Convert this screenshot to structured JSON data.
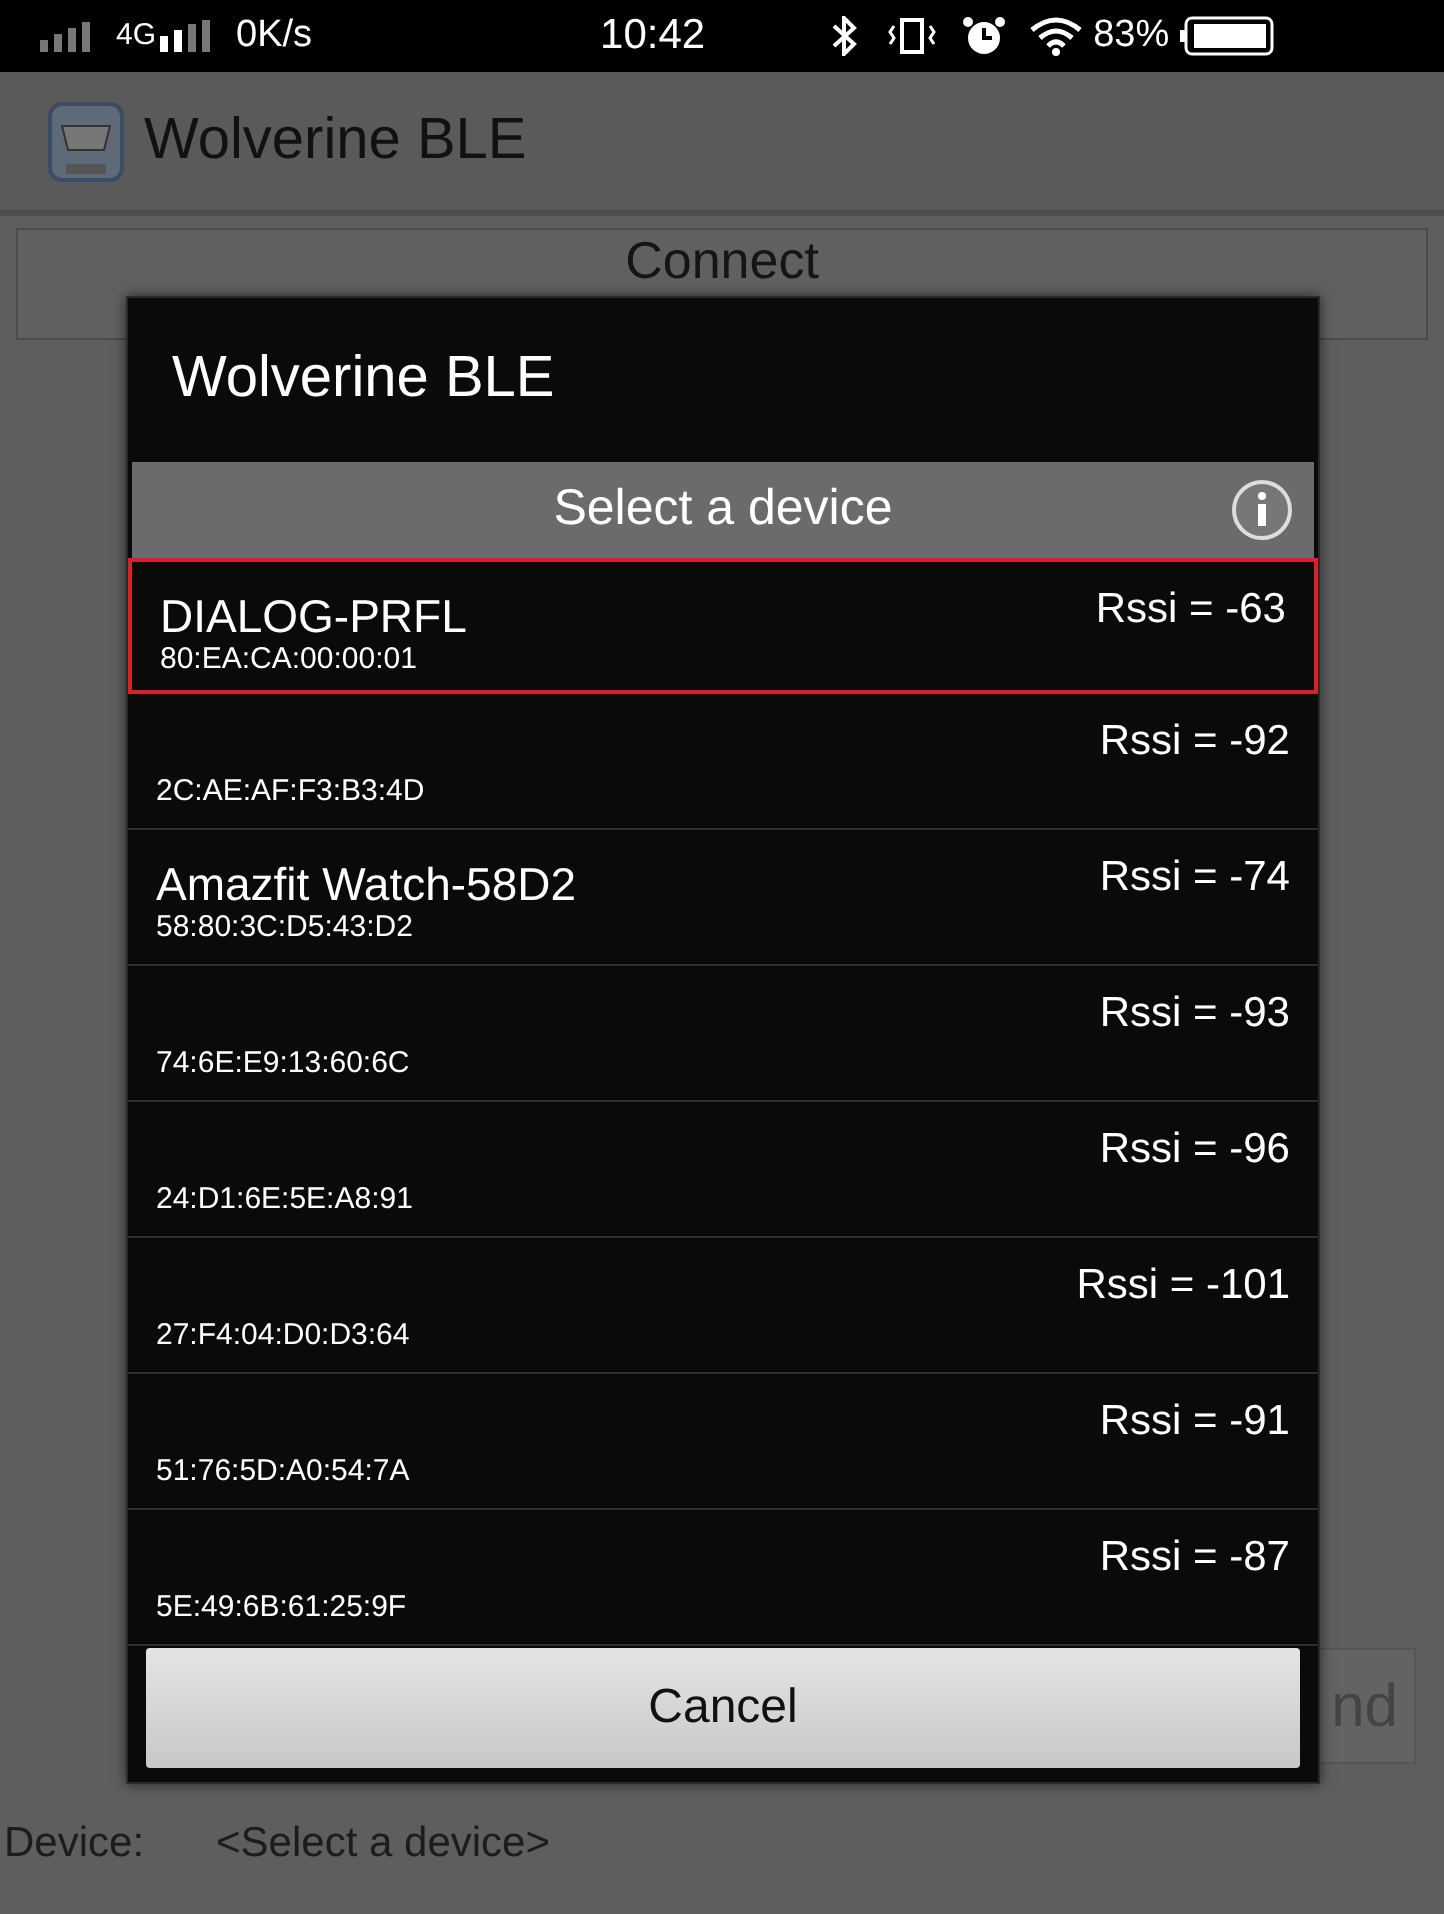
{
  "status_bar": {
    "network": "4G",
    "speed": "0K/s",
    "time": "10:42",
    "battery": "83%"
  },
  "app_bar": {
    "title": "Wolverine BLE"
  },
  "connect_button": "Connect",
  "send_button": "nd",
  "device_row": {
    "label": "Device:",
    "value": "<Select a device>"
  },
  "dialog": {
    "title": "Wolverine BLE",
    "header": "Select a device",
    "devices": [
      {
        "name": "DIALOG-PRFL",
        "address": "80:EA:CA:00:00:01",
        "rssi": "Rssi = -63",
        "selected": true
      },
      {
        "address": "2C:AE:AF:F3:B3:4D",
        "rssi": "Rssi = -92",
        "selected": false
      },
      {
        "name": "Amazfit Watch-58D2",
        "address": "58:80:3C:D5:43:D2",
        "rssi": "Rssi = -74",
        "selected": false
      },
      {
        "address": "74:6E:E9:13:60:6C",
        "rssi": "Rssi = -93",
        "selected": false
      },
      {
        "address": "24:D1:6E:5E:A8:91",
        "rssi": "Rssi = -96",
        "selected": false
      },
      {
        "address": "27:F4:04:D0:D3:64",
        "rssi": "Rssi = -101",
        "selected": false
      },
      {
        "address": "51:76:5D:A0:54:7A",
        "rssi": "Rssi = -91",
        "selected": false
      },
      {
        "address": "5E:49:6B:61:25:9F",
        "rssi": "Rssi = -87",
        "selected": false
      }
    ],
    "cancel": "Cancel"
  }
}
